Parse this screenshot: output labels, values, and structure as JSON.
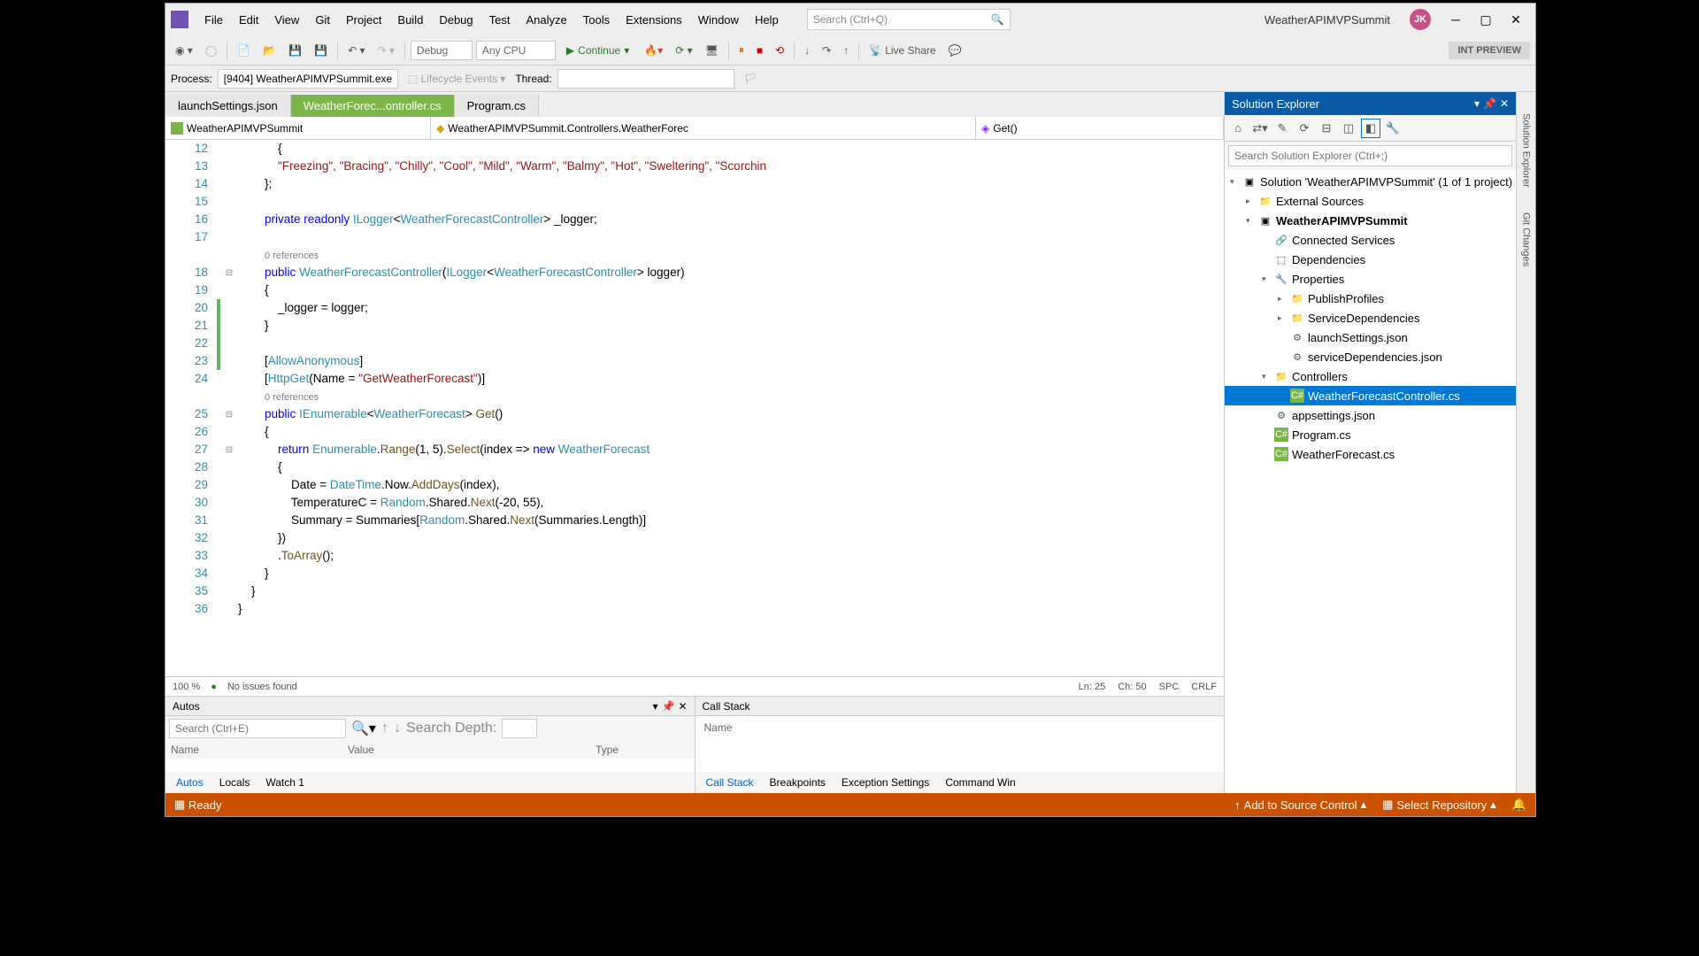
{
  "search": {
    "placeholder": "Search (Ctrl+Q)"
  },
  "menu": [
    "File",
    "Edit",
    "View",
    "Git",
    "Project",
    "Build",
    "Debug",
    "Test",
    "Analyze",
    "Tools",
    "Extensions",
    "Window",
    "Help"
  ],
  "solutionName": "WeatherAPIMVPSummit",
  "avatar": "JK",
  "toolbar": {
    "config": "Debug",
    "platform": "Any CPU",
    "continue": "Continue",
    "liveShare": "Live Share",
    "intPreview": "INT PREVIEW"
  },
  "toolbar2": {
    "processLabel": "Process:",
    "process": "[9404] WeatherAPIMVPSummit.exe",
    "lifecycle": "Lifecycle Events",
    "threadLabel": "Thread:"
  },
  "tabs": [
    {
      "label": "launchSettings.json",
      "active": false
    },
    {
      "label": "WeatherForec...ontroller.cs",
      "active": true
    },
    {
      "label": "Program.cs",
      "active": false
    }
  ],
  "contextBar": {
    "left": "WeatherAPIMVPSummit",
    "mid": "WeatherAPIMVPSummit.Controllers.WeatherForec",
    "right": "Get()"
  },
  "code": {
    "startLine": 12,
    "lines": [
      {
        "n": 12,
        "txt": "            {"
      },
      {
        "n": 13,
        "txt": "            \"Freezing\", \"Bracing\", \"Chilly\", \"Cool\", \"Mild\", \"Warm\", \"Balmy\", \"Hot\", \"Sweltering\", \"Scorchin",
        "str": true
      },
      {
        "n": 14,
        "txt": "        };"
      },
      {
        "n": 15,
        "txt": ""
      },
      {
        "n": 16,
        "html": "        <span class='kw'>private readonly</span> <span class='type'>ILogger</span>&lt;<span class='type'>WeatherForecastController</span>&gt; _logger;"
      },
      {
        "n": 17,
        "txt": ""
      },
      {
        "n": "",
        "html": "        <span class='com'>0 references</span>"
      },
      {
        "n": 18,
        "html": "        <span class='kw'>public</span> <span class='type'>WeatherForecastController</span>(<span class='type'>ILogger</span>&lt;<span class='type'>WeatherForecastController</span>&gt; logger)",
        "fold": true
      },
      {
        "n": 19,
        "txt": "        {"
      },
      {
        "n": 20,
        "txt": "            _logger = logger;",
        "mod": true
      },
      {
        "n": 21,
        "txt": "        }",
        "mod": true
      },
      {
        "n": 22,
        "txt": "",
        "mod": true
      },
      {
        "n": 23,
        "html": "        [<span class='attr'>AllowAnonymous</span>]",
        "mod": true
      },
      {
        "n": 24,
        "html": "        [<span class='attr'>HttpGet</span>(Name = <span class='str'>\"GetWeatherForecast\"</span>)]"
      },
      {
        "n": "",
        "html": "        <span class='com'>0 references</span>"
      },
      {
        "n": 25,
        "html": "        <span class='kw'>public</span> <span class='type'>IEnumerable</span>&lt;<span class='type'>WeatherForecast</span>&gt; <span class='method'>Get</span>()",
        "fold": true
      },
      {
        "n": 26,
        "txt": "        {"
      },
      {
        "n": 27,
        "html": "            <span class='kw'>return</span> <span class='type'>Enumerable</span>.<span class='method'>Range</span>(1, 5).<span class='method'>Select</span>(index =&gt; <span class='kw'>new</span> <span class='type'>WeatherForecast</span>",
        "fold": true
      },
      {
        "n": 28,
        "txt": "            {"
      },
      {
        "n": 29,
        "html": "                Date = <span class='type'>DateTime</span>.Now.<span class='method'>AddDays</span>(index),"
      },
      {
        "n": 30,
        "html": "                TemperatureC = <span class='type'>Random</span>.Shared.<span class='method'>Next</span>(-20, 55),"
      },
      {
        "n": 31,
        "html": "                Summary = Summaries[<span class='type'>Random</span>.Shared.<span class='method'>Next</span>(Summaries.Length)]"
      },
      {
        "n": 32,
        "txt": "            })"
      },
      {
        "n": 33,
        "html": "            .<span class='method'>ToArray</span>();"
      },
      {
        "n": 34,
        "txt": "        }"
      },
      {
        "n": 35,
        "txt": "    }"
      },
      {
        "n": 36,
        "txt": "}"
      }
    ]
  },
  "editorStatus": {
    "zoom": "100 %",
    "issues": "No issues found",
    "ln": "Ln: 25",
    "ch": "Ch: 50",
    "spc": "SPC",
    "crlf": "CRLF"
  },
  "autos": {
    "title": "Autos",
    "searchPlaceholder": "Search (Ctrl+E)",
    "depthLabel": "Search Depth:",
    "cols": [
      "Name",
      "Value",
      "Type"
    ],
    "tabs": [
      "Autos",
      "Locals",
      "Watch 1"
    ]
  },
  "callstack": {
    "title": "Call Stack",
    "col": "Name",
    "tabs": [
      "Call Stack",
      "Breakpoints",
      "Exception Settings",
      "Command Win"
    ]
  },
  "solExp": {
    "title": "Solution Explorer",
    "searchPlaceholder": "Search Solution Explorer (Ctrl+;)",
    "solution": "Solution 'WeatherAPIMVPSummit' (1 of 1 project)",
    "tree": [
      {
        "depth": 1,
        "label": "External Sources",
        "ico": "folder"
      },
      {
        "depth": 1,
        "label": "WeatherAPIMVPSummit",
        "ico": "proj",
        "bold": true,
        "exp": true
      },
      {
        "depth": 2,
        "label": "Connected Services",
        "ico": "conn"
      },
      {
        "depth": 2,
        "label": "Dependencies",
        "ico": "dep"
      },
      {
        "depth": 2,
        "label": "Properties",
        "ico": "wrench",
        "exp": true
      },
      {
        "depth": 3,
        "label": "PublishProfiles",
        "ico": "folder"
      },
      {
        "depth": 3,
        "label": "ServiceDependencies",
        "ico": "folder"
      },
      {
        "depth": 3,
        "label": "launchSettings.json",
        "ico": "json"
      },
      {
        "depth": 3,
        "label": "serviceDependencies.json",
        "ico": "json"
      },
      {
        "depth": 2,
        "label": "Controllers",
        "ico": "folder",
        "exp": true
      },
      {
        "depth": 3,
        "label": "WeatherForecastController.cs",
        "ico": "cs",
        "sel": true
      },
      {
        "depth": 2,
        "label": "appsettings.json",
        "ico": "json"
      },
      {
        "depth": 2,
        "label": "Program.cs",
        "ico": "cs"
      },
      {
        "depth": 2,
        "label": "WeatherForecast.cs",
        "ico": "cs"
      }
    ]
  },
  "rightTabs": [
    "Solution Explorer",
    "Git Changes"
  ],
  "statusbar": {
    "ready": "Ready",
    "addSource": "Add to Source Control",
    "selectRepo": "Select Repository"
  }
}
